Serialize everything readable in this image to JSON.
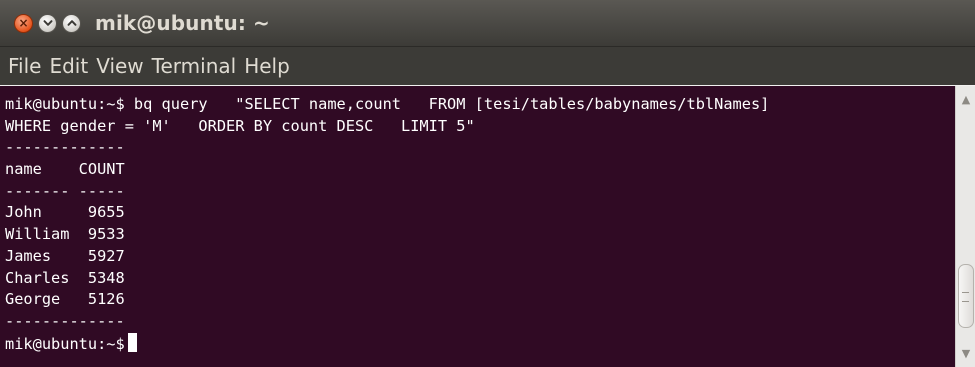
{
  "window": {
    "title": "mik@ubuntu: ~",
    "close_glyph": "×",
    "min_glyph": "minimize",
    "max_glyph": "maximize"
  },
  "menubar": {
    "items": [
      "File",
      "Edit",
      "View",
      "Terminal",
      "Help"
    ]
  },
  "terminal": {
    "lines": [
      "mik@ubuntu:~$ bq query   \"SELECT name,count   FROM [tesi/tables/babynames/tblNames]",
      "WHERE gender = 'M'   ORDER BY count DESC   LIMIT 5\"",
      "-------------",
      "name    COUNT",
      "------- -----",
      "John     9655",
      "William  9533",
      "James    5927",
      "Charles  5348",
      "George   5126",
      "-------------"
    ],
    "prompt": "mik@ubuntu:~$"
  },
  "colors": {
    "terminal_bg": "#300a24",
    "terminal_fg": "#ffffff",
    "titlebar_bg": "#3c3b37",
    "close_button": "#e5531c"
  },
  "icons": {
    "close": "close-icon",
    "minimize": "minimize-icon",
    "maximize": "maximize-icon",
    "scroll_up": "scroll-up-arrow-icon",
    "scroll_down": "scroll-down-arrow-icon"
  }
}
